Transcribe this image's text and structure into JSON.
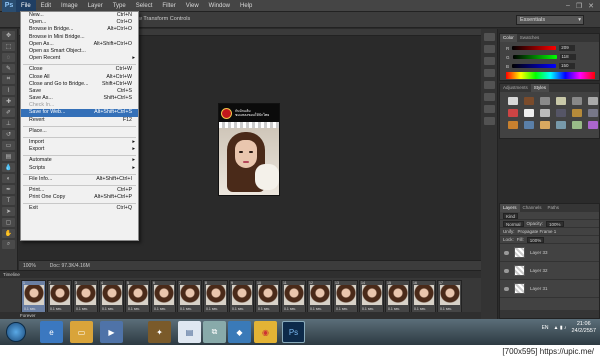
{
  "app": {
    "logo": "Ps",
    "menus": [
      "File",
      "Edit",
      "Image",
      "Layer",
      "Type",
      "Select",
      "Filter",
      "View",
      "Window",
      "Help"
    ],
    "window_controls": [
      "–",
      "❐",
      "✕"
    ]
  },
  "options_bar": {
    "text": "w Transform Controls",
    "workspace": "Essentials"
  },
  "canvas": {
    "doc_text_line1": "กันปักแล้ม",
    "doc_text_line2": "ชมแหลงชอบให้ปักไทย"
  },
  "status": {
    "zoom": "100%",
    "doc": "Doc: 97.3K/4.16M"
  },
  "file_menu": {
    "items": [
      {
        "label": "New...",
        "shortcut": "Ctrl+N"
      },
      {
        "label": "Open...",
        "shortcut": "Ctrl+O"
      },
      {
        "label": "Browse in Bridge...",
        "shortcut": "Alt+Ctrl+O"
      },
      {
        "label": "Browse in Mini Bridge...",
        "shortcut": ""
      },
      {
        "label": "Open As...",
        "shortcut": "Alt+Shift+Ctrl+O"
      },
      {
        "label": "Open as Smart Object...",
        "shortcut": ""
      },
      {
        "label": "Open Recent",
        "shortcut": ""
      },
      {
        "label": "Close",
        "shortcut": "Ctrl+W"
      },
      {
        "label": "Close All",
        "shortcut": "Alt+Ctrl+W"
      },
      {
        "label": "Close and Go to Bridge...",
        "shortcut": "Shift+Ctrl+W"
      },
      {
        "label": "Save",
        "shortcut": "Ctrl+S"
      },
      {
        "label": "Save As...",
        "shortcut": "Shift+Ctrl+S"
      },
      {
        "label": "Check In...",
        "shortcut": ""
      },
      {
        "label": "Save for Web...",
        "shortcut": "Alt+Shift+Ctrl+S"
      },
      {
        "label": "Revert",
        "shortcut": "F12"
      },
      {
        "label": "Place...",
        "shortcut": ""
      },
      {
        "label": "Import",
        "shortcut": ""
      },
      {
        "label": "Export",
        "shortcut": ""
      },
      {
        "label": "Automate",
        "shortcut": ""
      },
      {
        "label": "Scripts",
        "shortcut": ""
      },
      {
        "label": "File Info...",
        "shortcut": "Alt+Shift+Ctrl+I"
      },
      {
        "label": "Print...",
        "shortcut": "Ctrl+P"
      },
      {
        "label": "Print One Copy",
        "shortcut": "Alt+Shift+Ctrl+P"
      },
      {
        "label": "Exit",
        "shortcut": "Ctrl+Q"
      }
    ]
  },
  "color_panel": {
    "tabs": [
      "Color",
      "Swatches"
    ],
    "r": "209",
    "g": "118",
    "b": "150"
  },
  "adjust_panel": {
    "tabs": [
      "Adjustments",
      "Styles"
    ]
  },
  "layers_panel": {
    "tabs": [
      "Layers",
      "Channels",
      "Paths"
    ],
    "kind": "Kind",
    "blend": "Normal",
    "opacity_label": "Opacity:",
    "opacity": "100%",
    "unify_label": "Unify:",
    "propagate": "Propagate Frame 1",
    "lock_label": "Lock:",
    "fill_label": "Fill:",
    "fill": "100%",
    "layers": [
      "Layer 33",
      "Layer 32",
      "Layer 31"
    ]
  },
  "timeline": {
    "title": "Timeline",
    "delay": "0.1 sec.",
    "frame_numbers": [
      "1",
      "2",
      "3",
      "4",
      "5",
      "6",
      "7",
      "8",
      "9",
      "10",
      "11",
      "12",
      "13",
      "14",
      "15",
      "16",
      "17"
    ],
    "loop": "Forever"
  },
  "taskbar": {
    "lang": "EN",
    "time": "21:06",
    "date": "24/2/2557"
  },
  "watermark": "[700x595] https://upic.me/"
}
